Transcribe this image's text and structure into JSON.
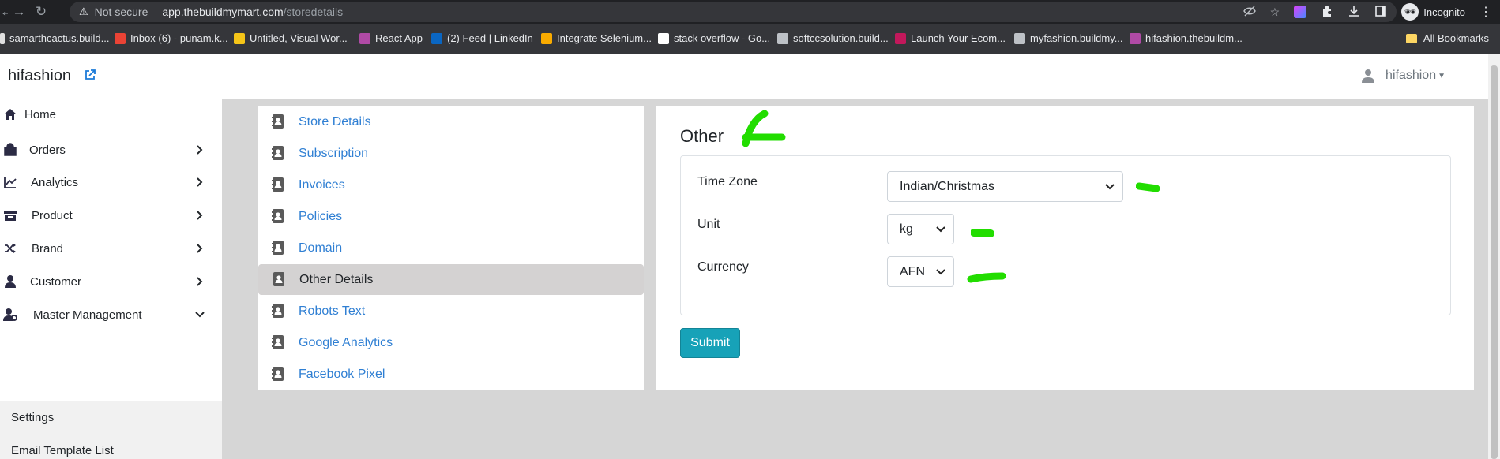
{
  "browser": {
    "security_label": "Not secure",
    "url_host": "app.thebuildmymart.com",
    "url_path": "/storedetails",
    "profile_label": "Incognito",
    "bookmarks": [
      {
        "label": "samarthcactus.build...",
        "color": "#e0e0e0"
      },
      {
        "label": "Inbox (6) - punam.k...",
        "color": "#ea4335"
      },
      {
        "label": "Untitled, Visual Wor...",
        "color": "#f5c518"
      },
      {
        "label": "React App",
        "color": "#b04aa6"
      },
      {
        "label": "(2) Feed | LinkedIn",
        "color": "#0a66c2"
      },
      {
        "label": "Integrate Selenium...",
        "color": "#f9ab00"
      },
      {
        "label": "stack overflow - Go...",
        "color": "#ffffff"
      },
      {
        "label": "softccsolution.build...",
        "color": "#bdc1c6"
      },
      {
        "label": "Launch Your Ecom...",
        "color": "#c2185b"
      },
      {
        "label": "myfashion.buildmy...",
        "color": "#bdc1c6"
      },
      {
        "label": "hifashion.thebuildm...",
        "color": "#b04aa6"
      }
    ],
    "all_bookmarks_label": "All Bookmarks"
  },
  "header": {
    "brand": "hifashion",
    "user_name": "hifashion"
  },
  "sidebar": {
    "items": [
      {
        "label": "Home",
        "icon": "home-icon",
        "chevron": "none"
      },
      {
        "label": "Orders",
        "icon": "bag-icon",
        "chevron": "right"
      },
      {
        "label": "Analytics",
        "icon": "chart-line-icon",
        "chevron": "right"
      },
      {
        "label": "Product",
        "icon": "box-icon",
        "chevron": "right"
      },
      {
        "label": "Brand",
        "icon": "shuffle-icon",
        "chevron": "right"
      },
      {
        "label": "Customer",
        "icon": "user-icon",
        "chevron": "right"
      },
      {
        "label": "Master Management",
        "icon": "user-gear-icon",
        "chevron": "down"
      }
    ],
    "submenu": [
      {
        "label": "Settings"
      },
      {
        "label": "Email Template List"
      }
    ]
  },
  "settings_menu": {
    "items": [
      {
        "label": "Store Details",
        "active": false
      },
      {
        "label": "Subscription",
        "active": false
      },
      {
        "label": "Invoices",
        "active": false
      },
      {
        "label": "Policies",
        "active": false
      },
      {
        "label": "Domain",
        "active": false
      },
      {
        "label": "Other Details",
        "active": true
      },
      {
        "label": "Robots Text",
        "active": false
      },
      {
        "label": "Google Analytics",
        "active": false
      },
      {
        "label": "Facebook Pixel",
        "active": false
      }
    ]
  },
  "form": {
    "title": "Other",
    "fields": [
      {
        "label": "Time Zone",
        "value": "Indian/Christmas"
      },
      {
        "label": "Unit",
        "value": "kg"
      },
      {
        "label": "Currency",
        "value": "AFN"
      }
    ],
    "submit_label": "Submit"
  },
  "colors": {
    "link": "#2f7fd3",
    "submit": "#17a2b8",
    "annotation": "#22dd00"
  }
}
